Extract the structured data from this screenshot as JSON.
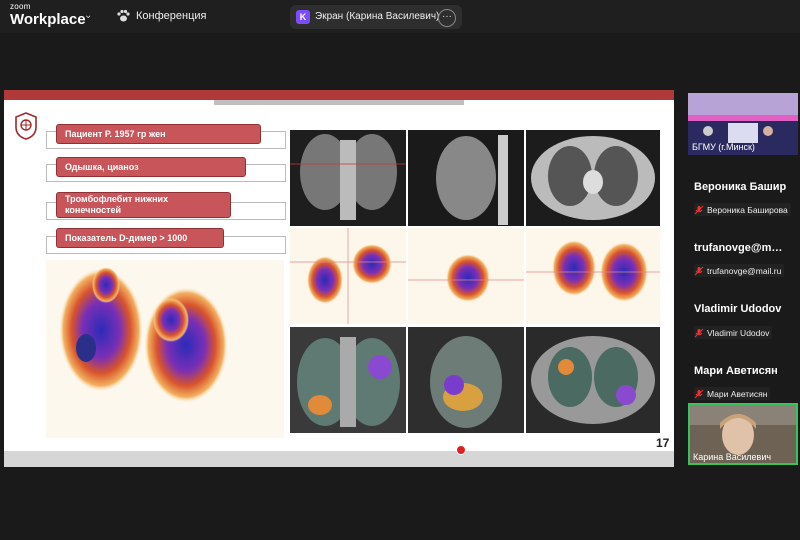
{
  "app": {
    "brand_top": "zoom",
    "brand_main": "Workplace"
  },
  "meeting": {
    "title": "Конференция"
  },
  "share": {
    "badge": "K",
    "label": "Экран (Карина Василевич)"
  },
  "slide": {
    "labels": [
      "Пациент Р. 1957 гр   жен",
      "Одышка, цианоз",
      "Тромбофлебит нижних конечностей",
      "Показатель D-димер > 1000"
    ],
    "page_number": "17"
  },
  "participants": {
    "video_tile_name": "БГМУ (г.Минск)",
    "people": [
      {
        "name": "Вероника  Башир",
        "label": "Вероника Баширова"
      },
      {
        "name": "trufanovge@m…",
        "label": "trufanovge@mail.ru"
      },
      {
        "name": "Vladimir Udodov",
        "label": "Vladimir Udodov"
      },
      {
        "name": "Мари Аветисян",
        "label": "Мари Аветисян"
      }
    ],
    "self_tile_name": "Карина Василевич"
  },
  "colors": {
    "accent_red": "#b03a3a",
    "label_red": "#c85559",
    "active_speaker": "#3ac35a"
  }
}
